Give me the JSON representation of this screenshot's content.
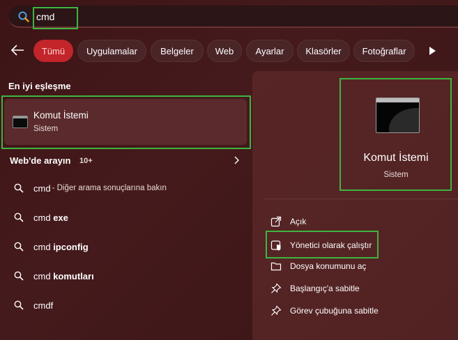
{
  "search": {
    "query": "cmd"
  },
  "filters": {
    "items": [
      "Tümü",
      "Uygulamalar",
      "Belgeler",
      "Web",
      "Ayarlar",
      "Klasörler",
      "Fotoğraflar"
    ]
  },
  "best_match": {
    "heading": "En iyi eşleşme",
    "title": "Komut İstemi",
    "subtitle": "Sistem"
  },
  "web": {
    "heading": "Web'de arayın",
    "count": "10+",
    "items": [
      {
        "query": "cmd",
        "hint": "- Diğer arama sonuçlarına bakın"
      },
      {
        "query_prefix": "cmd",
        "query_bold": "exe"
      },
      {
        "query_prefix": "cmd",
        "query_bold": "ipconfig"
      },
      {
        "query_prefix": "cmd",
        "query_bold": "komutları"
      },
      {
        "query_prefix": "cmd",
        "query_bold": "f"
      }
    ]
  },
  "detail": {
    "title": "Komut İstemi",
    "subtitle": "Sistem",
    "actions": [
      {
        "label": "Açık",
        "icon": "open-external-icon"
      },
      {
        "label": "Yönetici olarak çalıştır",
        "icon": "shield-admin-icon"
      },
      {
        "label": "Dosya konumunu aç",
        "icon": "folder-icon"
      },
      {
        "label": "Başlangıç'a sabitle",
        "icon": "pin-icon"
      },
      {
        "label": "Görev çubuğuna sabitle",
        "icon": "pin-icon"
      }
    ]
  },
  "colors": {
    "accent": "#c2252a",
    "highlight_box": "#3fb541",
    "background": "#3d1416"
  }
}
